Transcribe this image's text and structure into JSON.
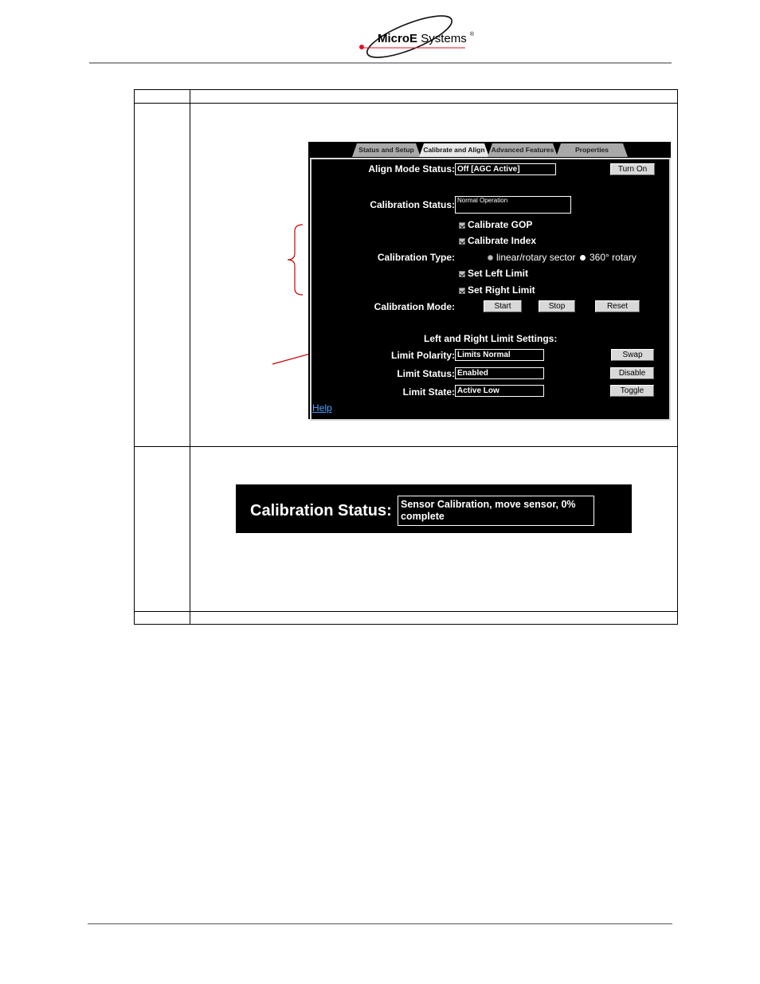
{
  "header": {
    "logo_text_bold": "MicroE",
    "logo_text_regular": "Systems",
    "logo_registered": "®"
  },
  "gui": {
    "tabs": [
      {
        "label": "Status and Setup",
        "active": false
      },
      {
        "label": "Calibrate and Align",
        "active": true
      },
      {
        "label": "Advanced Features",
        "active": false
      },
      {
        "label": "Properties",
        "active": false
      }
    ],
    "align_mode": {
      "label": "Align Mode Status:",
      "value": "Off [AGC Active]",
      "button": "Turn On"
    },
    "calibration_status": {
      "label": "Calibration Status:",
      "value": "Normal Operation"
    },
    "checkboxes": {
      "gop": {
        "label": "Calibrate GOP",
        "checked": true
      },
      "index": {
        "label": "Calibrate Index",
        "checked": true
      },
      "left_limit": {
        "label": "Set Left Limit",
        "checked": true
      },
      "right_limit": {
        "label": "Set Right Limit",
        "checked": true
      }
    },
    "calibration_type": {
      "label": "Calibration Type:",
      "options": [
        "linear/rotary sector",
        "360° rotary"
      ],
      "selected": "360° rotary"
    },
    "calibration_mode": {
      "label": "Calibration Mode:",
      "start": "Start",
      "stop": "Stop",
      "reset": "Reset"
    },
    "limits": {
      "heading": "Left and Right Limit Settings:",
      "polarity": {
        "label": "Limit Polarity:",
        "value": "Limits Normal",
        "button": "Swap"
      },
      "status": {
        "label": "Limit Status:",
        "value": "Enabled",
        "button": "Disable"
      },
      "state": {
        "label": "Limit State:",
        "value": "Active Low",
        "button": "Toggle"
      }
    },
    "help": "Help"
  },
  "calibration_progress": {
    "label": "Calibration Status:",
    "value_line1": "Sensor Calibration, move sensor, 0%",
    "value_line2": "complete"
  },
  "colors": {
    "annotation": "#cc0000",
    "link": "#4aa3ff",
    "gui_background": "#000000"
  }
}
